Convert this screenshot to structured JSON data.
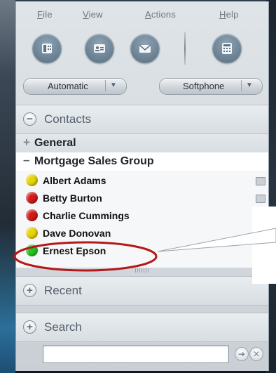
{
  "menu": {
    "file": {
      "label": "File",
      "accel": "F",
      "rest": "ile"
    },
    "view": {
      "label": "View",
      "accel": "V",
      "rest": "iew"
    },
    "actions": {
      "label": "Actions",
      "accel": "A",
      "rest": "ctions"
    },
    "help": {
      "label": "Help",
      "accel": "H",
      "rest": "elp"
    }
  },
  "toolbar": {
    "buttons": [
      {
        "icon": "phone-icon"
      },
      {
        "icon": "contact-card-icon"
      },
      {
        "icon": "mail-icon"
      },
      {
        "icon": "dialpad-icon"
      }
    ],
    "status_select": "Automatic",
    "device_select": "Softphone"
  },
  "sections": {
    "contacts": {
      "label": "Contacts",
      "icon": "collapse-icon"
    },
    "recent": {
      "label": "Recent",
      "icon": "expand-icon"
    },
    "search": {
      "label": "Search",
      "icon": "expand-icon"
    }
  },
  "groups": {
    "general": {
      "label": "General",
      "sign": "+"
    },
    "mortgage": {
      "label": "Mortgage Sales Group",
      "sign": "–"
    }
  },
  "contacts": [
    {
      "name": "Albert Adams",
      "status_color": "#e8d400"
    },
    {
      "name": "Betty Burton",
      "status_color": "#d11a1a"
    },
    {
      "name": "Charlie Cummings",
      "status_color": "#d11a1a"
    },
    {
      "name": "Dave Donovan",
      "status_color": "#e8d400"
    },
    {
      "name": "Ernest Epson",
      "status_color": "#22c51f"
    }
  ],
  "search": {
    "value": "",
    "go_icon": "arrow-right-icon",
    "clear_icon": "clear-icon"
  },
  "colors": {
    "highlight_ellipse": "#b51818",
    "accent_blue": "#4a6a8a"
  }
}
